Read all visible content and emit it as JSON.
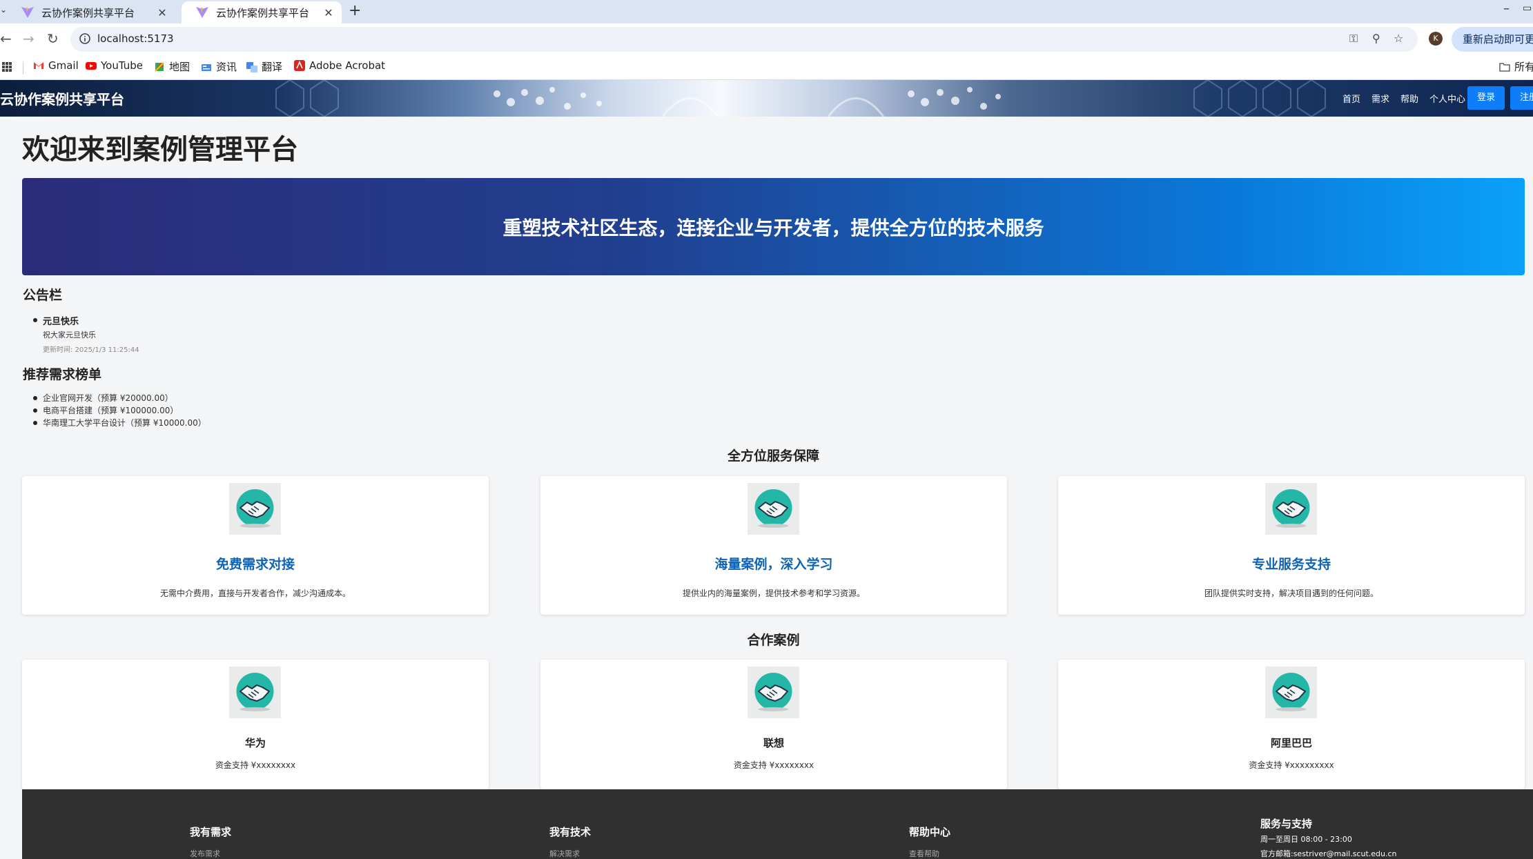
{
  "browser": {
    "tabs": [
      {
        "title": "云协作案例共享平台",
        "active": false
      },
      {
        "title": "云协作案例共享平台",
        "active": true
      }
    ],
    "url": "localhost:5173",
    "restart_label": "重新启动即可更新",
    "profile_initial": "K",
    "bookmarks": [
      {
        "label": "Gmail",
        "icon": "gmail-icon"
      },
      {
        "label": "YouTube",
        "icon": "youtube-icon"
      },
      {
        "label": "地图",
        "icon": "maps-icon"
      },
      {
        "label": "资讯",
        "icon": "news-icon"
      },
      {
        "label": "翻译",
        "icon": "translate-icon"
      },
      {
        "label": "Adobe Acrobat",
        "icon": "acrobat-icon"
      }
    ],
    "all_bookmarks_label": "所有书签"
  },
  "header": {
    "logo": "云协作案例共享平台",
    "nav": [
      "首页",
      "需求",
      "帮助",
      "个人中心"
    ],
    "login": "登录",
    "register": "注册",
    "accent": "#0d7ef7"
  },
  "main": {
    "title": "欢迎来到案例管理平台",
    "hero_text": "重塑技术社区生态，连接企业与开发者，提供全方位的技术服务",
    "notice": {
      "heading": "公告栏",
      "items": [
        {
          "title": "元旦快乐",
          "content": "祝大家元旦快乐",
          "time": "更新时间: 2025/1/3 11:25:44"
        }
      ]
    },
    "ranking": {
      "heading": "推荐需求榜单",
      "items": [
        "企业官网开发（预算 ¥20000.00）",
        "电商平台搭建（预算 ¥100000.00）",
        "华南理工大学平台设计（预算 ¥10000.00）"
      ]
    },
    "services": {
      "heading": "全方位服务保障",
      "cards": [
        {
          "title": "免费需求对接",
          "desc": "无需中介费用，直接与开发者合作，减少沟通成本。"
        },
        {
          "title": "海量案例，深入学习",
          "desc": "提供业内的海量案例，提供技术参考和学习资源。"
        },
        {
          "title": "专业服务支持",
          "desc": "团队提供实时支持，解决项目遇到的任何问题。"
        }
      ]
    },
    "partners": {
      "heading": "合作案例",
      "cards": [
        {
          "name": "华为",
          "desc": "资金支持 ¥xxxxxxxx"
        },
        {
          "name": "联想",
          "desc": "资金支持 ¥xxxxxxxx"
        },
        {
          "name": "阿里巴巴",
          "desc": "资金支持 ¥xxxxxxxxx"
        }
      ]
    }
  },
  "footer": {
    "columns": [
      {
        "title": "我有需求",
        "link": "发布需求"
      },
      {
        "title": "我有技术",
        "link": "解决需求"
      },
      {
        "title": "帮助中心",
        "link": "查看帮助"
      }
    ],
    "support": {
      "title": "服务与支持",
      "hours": "周一至周日 08:00 - 23:00",
      "email": "官方邮箱:sestriver@mail.scut.edu.cn"
    }
  }
}
